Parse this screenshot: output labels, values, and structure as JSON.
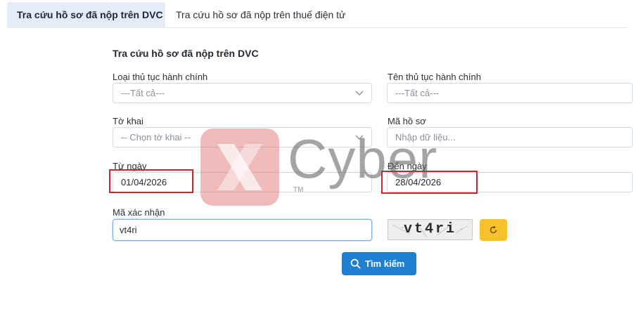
{
  "tabs": [
    {
      "label": "Tra cứu hồ sơ đã nộp trên DVC",
      "active": true
    },
    {
      "label": "Tra cứu hồ sơ đã nộp trên thuế điện tử",
      "active": false
    }
  ],
  "form": {
    "title": "Tra cứu hồ sơ đã nộp trên DVC",
    "procedure_type": {
      "label": "Loại thủ tục hành chính",
      "value": "---Tất cả---"
    },
    "procedure_name": {
      "label": "Tên thủ tục hành chính",
      "value": "---Tất cả---"
    },
    "declaration": {
      "label": "Tờ khai",
      "value": "-- Chọn tờ khai --"
    },
    "dossier_code": {
      "label": "Mã hồ sơ",
      "placeholder": "Nhập dữ liệu..."
    },
    "from_date": {
      "label": "Từ ngày",
      "value": "01/04/2026"
    },
    "to_date": {
      "label": "Đến ngày",
      "value": "28/04/2026"
    },
    "captcha": {
      "label": "Mã xác nhận",
      "value": "vt4ri",
      "image_text": "vt4ri"
    },
    "search_label": "Tìm kiếm"
  },
  "watermark": {
    "text": "Cyber",
    "tm": "TM"
  },
  "colors": {
    "primary": "#1f7fd1",
    "refresh": "#f6c12c",
    "highlight_border": "#d3242a",
    "active_tab_bg": "#e4edf7"
  },
  "icons": {
    "search": "search-icon",
    "refresh": "refresh-icon",
    "dropdown": "chevron-down-icon"
  }
}
